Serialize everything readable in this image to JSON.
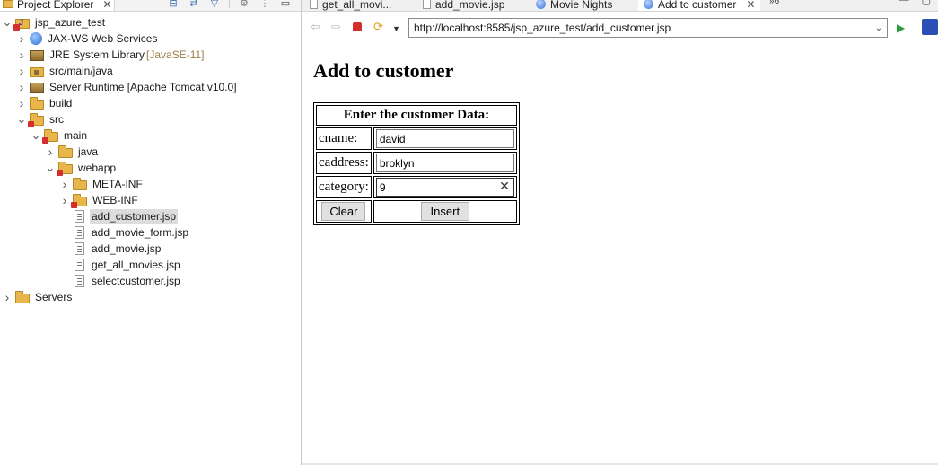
{
  "explorer": {
    "tab_label": "Project Explorer",
    "tree": [
      {
        "label": "jsp_azure_test",
        "icon": "project-icon",
        "level": 0,
        "expanded": true
      },
      {
        "label": "JAX-WS Web Services",
        "icon": "web-services-icon",
        "level": 1,
        "expanded": false
      },
      {
        "label": "JRE System Library",
        "decoration": "[JavaSE-11]",
        "icon": "library-icon",
        "level": 1,
        "expanded": false
      },
      {
        "label": "src/main/java",
        "icon": "source-folder-icon",
        "level": 1,
        "expanded": false
      },
      {
        "label": "Server Runtime [Apache Tomcat v10.0]",
        "icon": "library-icon",
        "level": 1,
        "expanded": false
      },
      {
        "label": "build",
        "icon": "folder-icon",
        "level": 1,
        "expanded": false
      },
      {
        "label": "src",
        "icon": "folder-error-icon",
        "level": 1,
        "expanded": true
      },
      {
        "label": "main",
        "icon": "folder-error-icon",
        "level": 2,
        "expanded": true
      },
      {
        "label": "java",
        "icon": "folder-icon",
        "level": 3,
        "expanded": false
      },
      {
        "label": "webapp",
        "icon": "folder-error-icon",
        "level": 3,
        "expanded": true
      },
      {
        "label": "META-INF",
        "icon": "folder-icon",
        "level": 4,
        "expanded": false
      },
      {
        "label": "WEB-INF",
        "icon": "folder-error-icon",
        "level": 4,
        "expanded": false
      },
      {
        "label": "add_customer.jsp",
        "icon": "jsp-file-icon",
        "level": 4,
        "leaf": true,
        "selected": true
      },
      {
        "label": "add_movie_form.jsp",
        "icon": "jsp-file-icon",
        "level": 4,
        "leaf": true
      },
      {
        "label": "add_movie.jsp",
        "icon": "jsp-file-icon",
        "level": 4,
        "leaf": true
      },
      {
        "label": "get_all_movies.jsp",
        "icon": "jsp-file-icon",
        "level": 4,
        "leaf": true
      },
      {
        "label": "selectcustomer.jsp",
        "icon": "jsp-file-icon",
        "level": 4,
        "leaf": true
      },
      {
        "label": "Servers",
        "icon": "folder-icon",
        "level": 0,
        "expanded": false
      }
    ]
  },
  "editor": {
    "tabs": [
      {
        "label": "get_all_movi...",
        "icon": "jsp-file-icon",
        "active": false
      },
      {
        "label": "add_movie.jsp",
        "icon": "jsp-file-icon",
        "active": false
      },
      {
        "label": "Movie Nights",
        "icon": "globe-icon",
        "active": false
      },
      {
        "label": "Add to customer",
        "icon": "globe-icon",
        "active": true
      }
    ],
    "overflow_count": "6"
  },
  "browser": {
    "url": "http://localhost:8585/jsp_azure_test/add_customer.jsp"
  },
  "page": {
    "title": "Add to customer",
    "form": {
      "header": "Enter the customer Data:",
      "cname_label": "cname:",
      "cname_value": "david",
      "caddress_label": "caddress:",
      "caddress_value": "broklyn",
      "category_label": "category:",
      "category_value": "9",
      "clear_button": "Clear",
      "insert_button": "Insert"
    }
  },
  "colors": {
    "selection": "#dcdcdc",
    "decoration": "#9a7b4a",
    "run_green": "#2e9b3a",
    "stop_red": "#d32f2f"
  }
}
